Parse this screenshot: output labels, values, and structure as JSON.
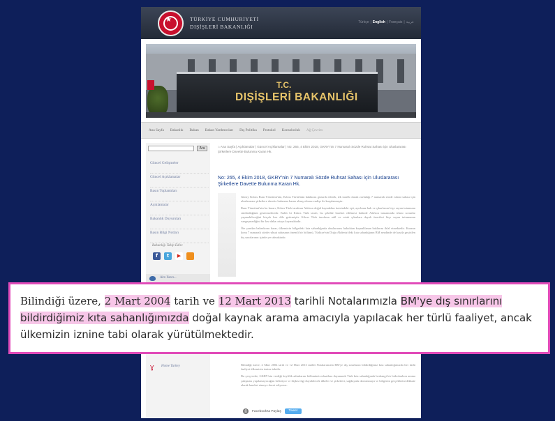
{
  "header": {
    "ministry_line1": "TÜRKİYE CUMHURİYETİ",
    "ministry_line2": "DIŞİŞLERİ BAKANLIĞI",
    "languages": [
      "Türkçe",
      "English",
      "Français",
      "عربية"
    ],
    "active_language": "English"
  },
  "banner": {
    "sign_top": "T.C.",
    "sign_main": "DIŞİŞLERİ BAKANLIĞI"
  },
  "nav": {
    "items": [
      "Ana Sayfa",
      "Bakanlık",
      "Bakan",
      "Bakan Yardımcıları",
      "Dış Politika",
      "Protokol",
      "Konsolosluk",
      "Ağ Çevrim"
    ]
  },
  "sidebar": {
    "search_button": "Ara",
    "items": [
      "Güncel Gelişmeler",
      "Güncel Açıklamalar",
      "Basın Toplantıları",
      "Açıklamalar",
      "Bakanlık Duyuruları",
      "Basın Bilgi Notları"
    ],
    "follow_label": "Bakanlığı Takip Edin:",
    "social": [
      "f",
      "t",
      "▶",
      "rss"
    ],
    "aim_label": "Aim Yazın...",
    "home_turkey_label": "Home Turkey"
  },
  "content": {
    "breadcrumb": "⌂ Ana Sayfa | Açıklamalar | Güncel Açıklamalar | No: 265, 4 Ekim 2018, GKRY'nin 7 Numaralı Sözde Ruhsat Sahası için Uluslararası Şirketlere Davette Bulunma Karan Hk.",
    "headline": "No: 265, 4 Ekim 2018, GKRY'nin 7 Numaralı Sözde Ruhsat Sahası için Uluslararası Şirketlere Davette Bulunma Karan Hk.",
    "paragraphs": [
      "Güney Kıbrıs Rum Yönetimi'nin, Kıbrıs Türkü'nün haklarını gözardı ederek, tek taraflı olarak zorladığı 7 numaralı sözde ruhsat sahası için uluslararası şirketlere davette bulunma kararı almış olması endişe ile karşılanmıştır.",
      "Rum Yönetimi'nin bu kararı, Kıbrıs Türk tarafının Ada'nın doğal kaynakları üzerindeki eşit, ayrılmaz hak ve çıkarlarını hiçe sayan tutumunu sürdürdüğünü göstermektedir. Kaldı ki Kıbrıs Türk tarafı, bu şekilde hareket edilmesi halinde Ada'nın tamamında tekrar sorunlar yaşanabileceğini birçok kez dile getirmiştir. Kıbrıs Türk tarafının adil ve ortak çıkarlara dayalı önerileri hiçe sayan tutumunun vazgeçmediğini bir kez daha ortaya koymaktadır.",
      "Öte yandan bahsekonu karar, ülkemizin bölgedeki kıta sahanlığında uluslararası hukuktan kaynaklanan haklarını ihlal etmektedir. Kararın konu 7 numaralı sözde ruhsat sahasının önemli bir bölümü, Türkiye'nin Doğu Akdeniz'deki kıta sahanlığının BM nezdinde de kayda geçirilen dış sınırlarının içinde yer almaktadır."
    ],
    "paragraphs_bottom": [
      "Bilindiği üzere, 2 Mart 2004 tarih ve 12 Mart 2013 tarihli Notalarımızla BM'ye dış sınırlarını bildirdiğimiz kıta sahanlığımızda her türlü faaliyet ülkemizin iznine tabidir.",
      "Bu çerçevede, GKRY'nin verdiği keyfilik adımlarını bölümünü ruhsatlara dayanarak Türk kıta sahanlığında herhangi bir hidrokarbon arama çalışması yapılamayacağını belirtiyor ve ilişkisi ilgi duyabilecek ülkeler ve şirketleri, sağduyulu davranmaya ve bölgenin gerçeklerini dikkate alarak hareket etmeye davet ediyoruz."
    ],
    "share_label": "Facebook'ta Paylaş",
    "tweet_label": "Tweet"
  },
  "highlight_box": {
    "t1": "Bilindiği üzere, ",
    "h1": "2 Mart 2004",
    "t2": " tarih ve ",
    "h2": "12 Mart 2013",
    "t3": " tarihli Notalarımızla ",
    "h3": "BM'ye dış sınırlarını bildirdiğimiz kıta sahanlığımızda",
    "t4": " doğal kaynak arama amacıyla yapılacak her türlü faaliyet, ancak ülkemizin iznine tabi olarak yürütülmektedir.",
    "highlight_color": "#f7c6e8",
    "border_color": "#e14bb9"
  }
}
